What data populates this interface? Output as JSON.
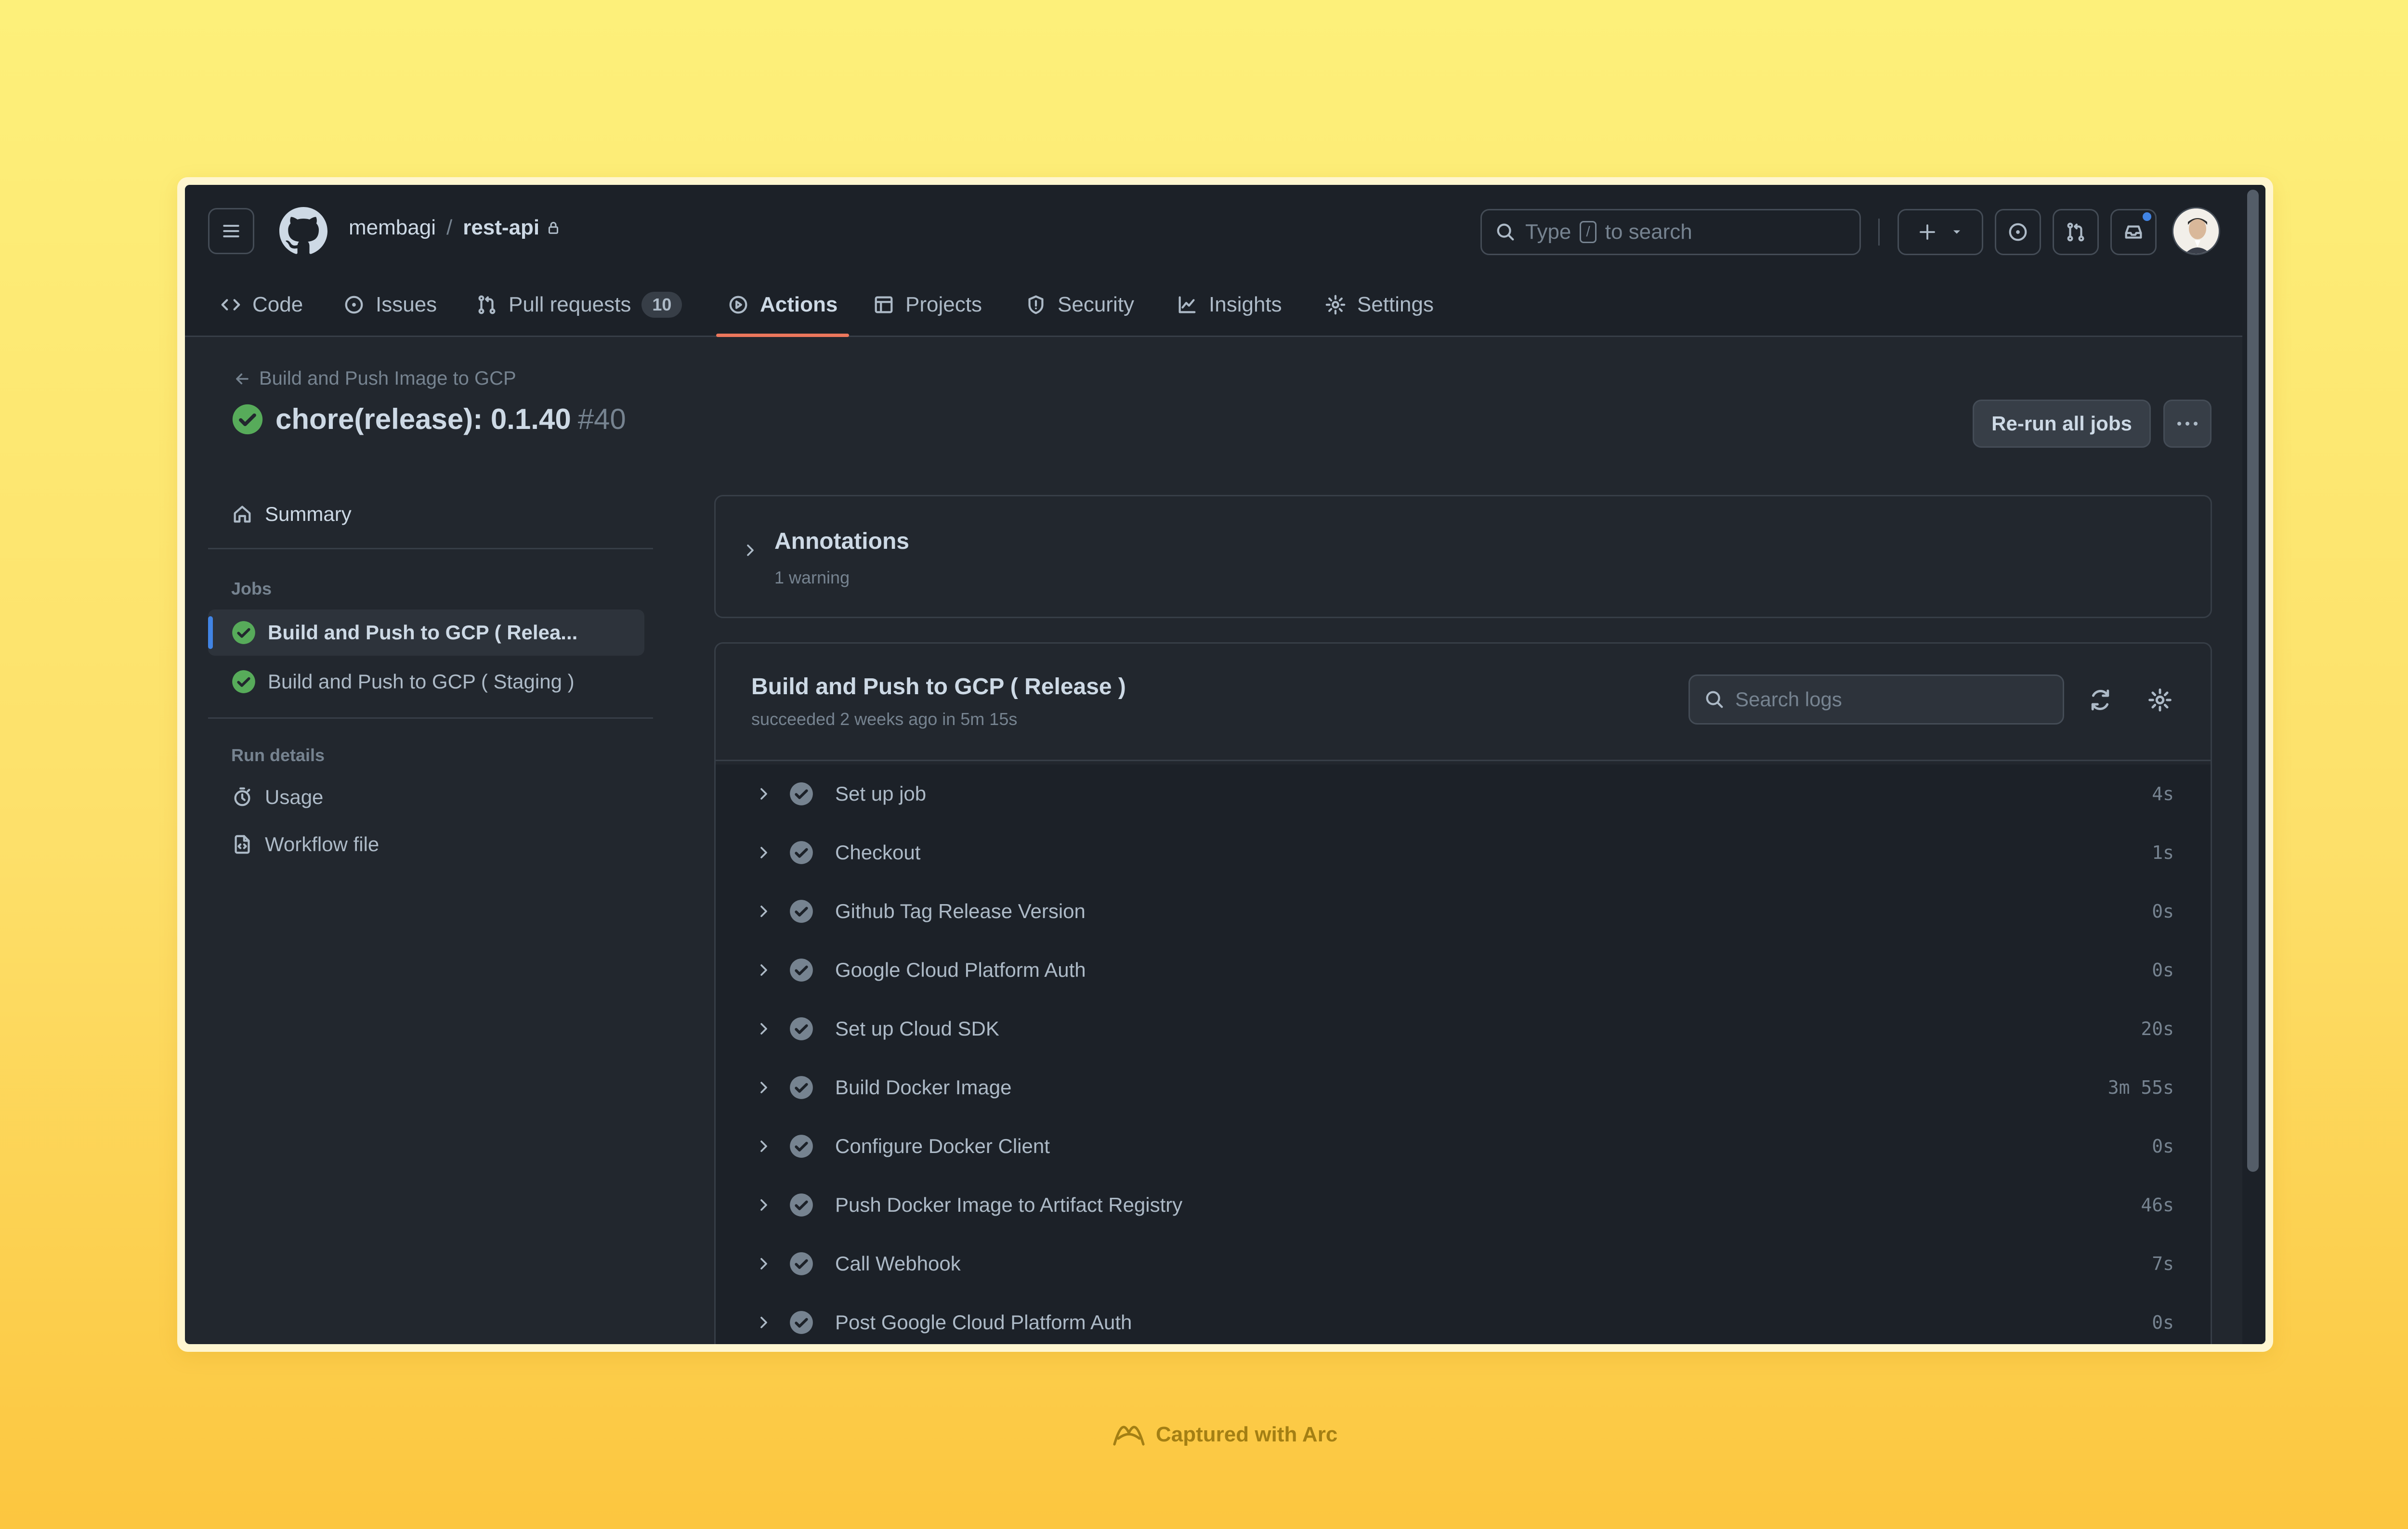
{
  "repo": {
    "owner": "membagi",
    "separator": "/",
    "name": "rest-api"
  },
  "search": {
    "prefix": "Type",
    "key": "/",
    "suffix": "to search"
  },
  "tabs": [
    {
      "label": "Code",
      "icon": "code-icon"
    },
    {
      "label": "Issues",
      "icon": "issue-icon"
    },
    {
      "label": "Pull requests",
      "icon": "pull-request-icon",
      "count": "10"
    },
    {
      "label": "Actions",
      "icon": "play-icon",
      "active": true
    },
    {
      "label": "Projects",
      "icon": "table-icon"
    },
    {
      "label": "Security",
      "icon": "shield-icon"
    },
    {
      "label": "Insights",
      "icon": "graph-icon"
    },
    {
      "label": "Settings",
      "icon": "gear-icon"
    }
  ],
  "run": {
    "back_label": "Build and Push Image to GCP",
    "title": "chore(release): 0.1.40",
    "number": "#40",
    "rerun_label": "Re-run all jobs"
  },
  "sidebar": {
    "summary": "Summary",
    "jobs_heading": "Jobs",
    "jobs": [
      {
        "label": "Build and Push to GCP ( Relea...",
        "status": "success",
        "selected": true
      },
      {
        "label": "Build and Push to GCP ( Staging )",
        "status": "success",
        "selected": false
      }
    ],
    "run_details_heading": "Run details",
    "usage": "Usage",
    "workflow_file": "Workflow file"
  },
  "annotations": {
    "title": "Annotations",
    "subtitle": "1 warning"
  },
  "job": {
    "title": "Build and Push to GCP ( Release )",
    "subtitle": "succeeded 2 weeks ago in 5m 15s",
    "search_placeholder": "Search logs"
  },
  "steps": [
    {
      "name": "Set up job",
      "duration": "4s"
    },
    {
      "name": "Checkout",
      "duration": "1s"
    },
    {
      "name": "Github Tag Release Version",
      "duration": "0s"
    },
    {
      "name": "Google Cloud Platform Auth",
      "duration": "0s"
    },
    {
      "name": "Set up Cloud SDK",
      "duration": "20s"
    },
    {
      "name": "Build Docker Image",
      "duration": "3m 55s"
    },
    {
      "name": "Configure Docker Client",
      "duration": "0s"
    },
    {
      "name": "Push Docker Image to Artifact Registry",
      "duration": "46s"
    },
    {
      "name": "Call Webhook",
      "duration": "7s"
    },
    {
      "name": "Post Google Cloud Platform Auth",
      "duration": "0s"
    }
  ],
  "footer": {
    "label": "Captured with Arc"
  },
  "colors": {
    "accent": "#ec775c",
    "success": "#57ab5a",
    "background": "#22272e",
    "header": "#1c2128"
  }
}
